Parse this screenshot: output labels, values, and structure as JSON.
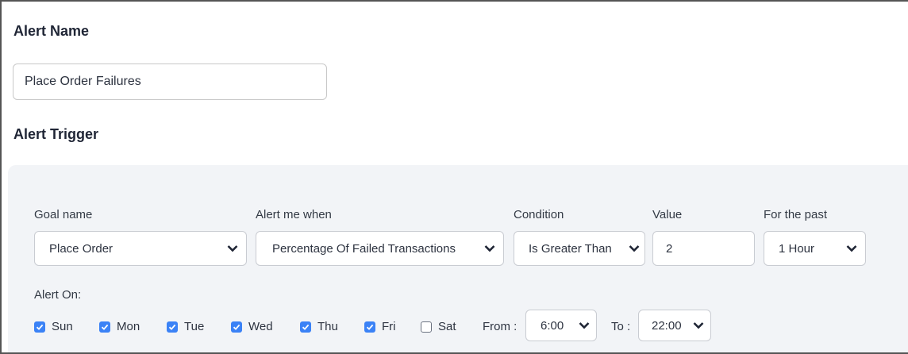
{
  "alert_name": {
    "heading": "Alert Name",
    "value": "Place Order Failures"
  },
  "alert_trigger": {
    "heading": "Alert Trigger",
    "goal_name": {
      "label": "Goal name",
      "selected": "Place Order"
    },
    "alert_me_when": {
      "label": "Alert me when",
      "selected": "Percentage Of Failed Transactions"
    },
    "condition": {
      "label": "Condition",
      "selected": "Is Greater Than"
    },
    "value": {
      "label": "Value",
      "value": "2"
    },
    "for_the_past": {
      "label": "For the past",
      "selected": "1 Hour"
    }
  },
  "alert_on": {
    "label": "Alert On:",
    "days": [
      {
        "label": "Sun",
        "checked": true
      },
      {
        "label": "Mon",
        "checked": true
      },
      {
        "label": "Tue",
        "checked": true
      },
      {
        "label": "Wed",
        "checked": true
      },
      {
        "label": "Thu",
        "checked": true
      },
      {
        "label": "Fri",
        "checked": true
      },
      {
        "label": "Sat",
        "checked": false
      }
    ],
    "from": {
      "label": "From :",
      "selected": "6:00"
    },
    "to": {
      "label": "To :",
      "selected": "22:00"
    }
  },
  "colors": {
    "checkbox_on": "#3b82f6",
    "panel_bg": "#f2f4f7",
    "heading": "#1f2535"
  }
}
